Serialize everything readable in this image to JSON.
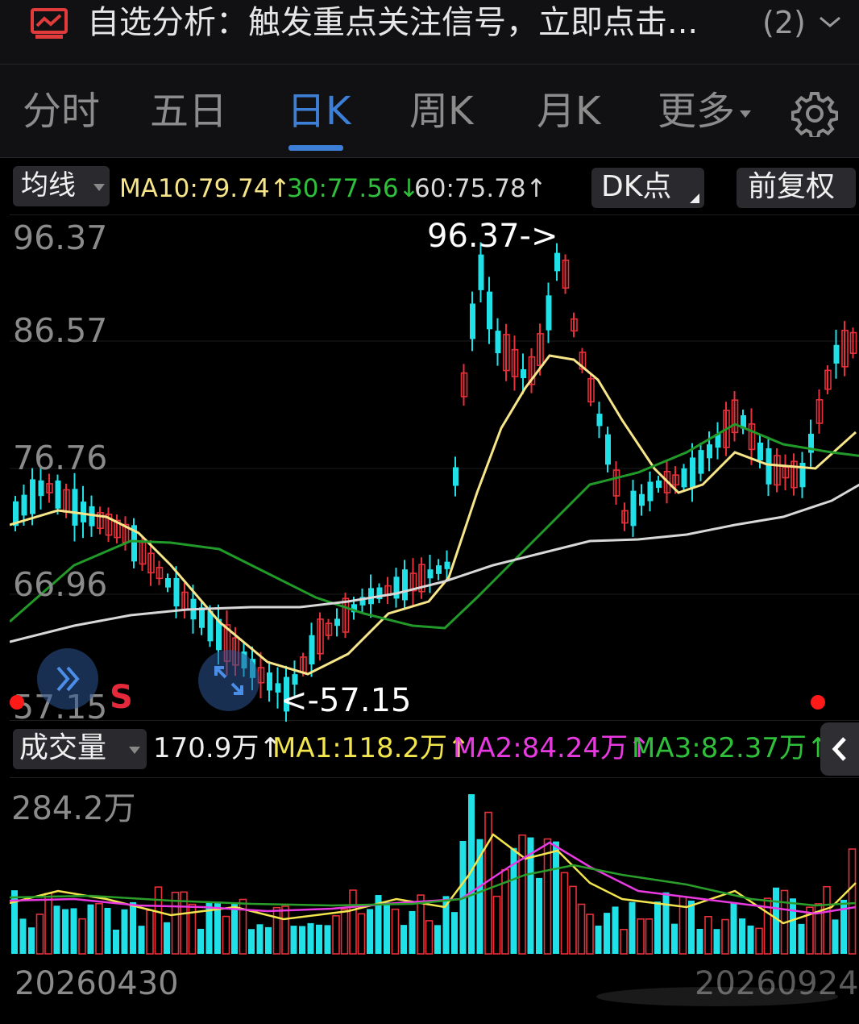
{
  "alert": {
    "text": "自选分析：触发重点关注信号，立即点击...",
    "count": "(2)",
    "icon": "chart-monitor-icon"
  },
  "tabs": [
    {
      "label": "分时"
    },
    {
      "label": "五日"
    },
    {
      "label": "日K",
      "active": true
    },
    {
      "label": "周K"
    },
    {
      "label": "月K"
    },
    {
      "label": "更多"
    }
  ],
  "ma_bar": {
    "selector": "均线",
    "ma10": "MA10:79.74↑",
    "ma30": "30:77.56↓",
    "ma60": "60:75.78↑",
    "dk_button": "DK点",
    "adjust_button": "前复权"
  },
  "kline": {
    "price_labels": [
      "96.37",
      "86.57",
      "76.76",
      "66.96",
      "57.15"
    ],
    "high_label": "96.37->",
    "low_label": "<-57.15",
    "signal_mark": "S"
  },
  "volume_bar": {
    "selector": "成交量",
    "vol": "170.9万↑",
    "ma1": "MA1:118.2万↑",
    "ma2": "MA2:84.24万↑",
    "ma3": "MA3:82.37万↑",
    "max_label": "284.2万"
  },
  "dates": {
    "start": "20260430",
    "end": "20260924"
  },
  "colors": {
    "up": "#e8303a",
    "down": "#20e0e8",
    "ma10": "#f7e58a",
    "ma30": "#229a2a",
    "ma60": "#d8d8d8",
    "vol_ma1": "#f2e54e",
    "vol_ma2": "#e83ae0",
    "vol_ma3": "#2a9e2a",
    "accent": "#3d7fd6"
  }
}
